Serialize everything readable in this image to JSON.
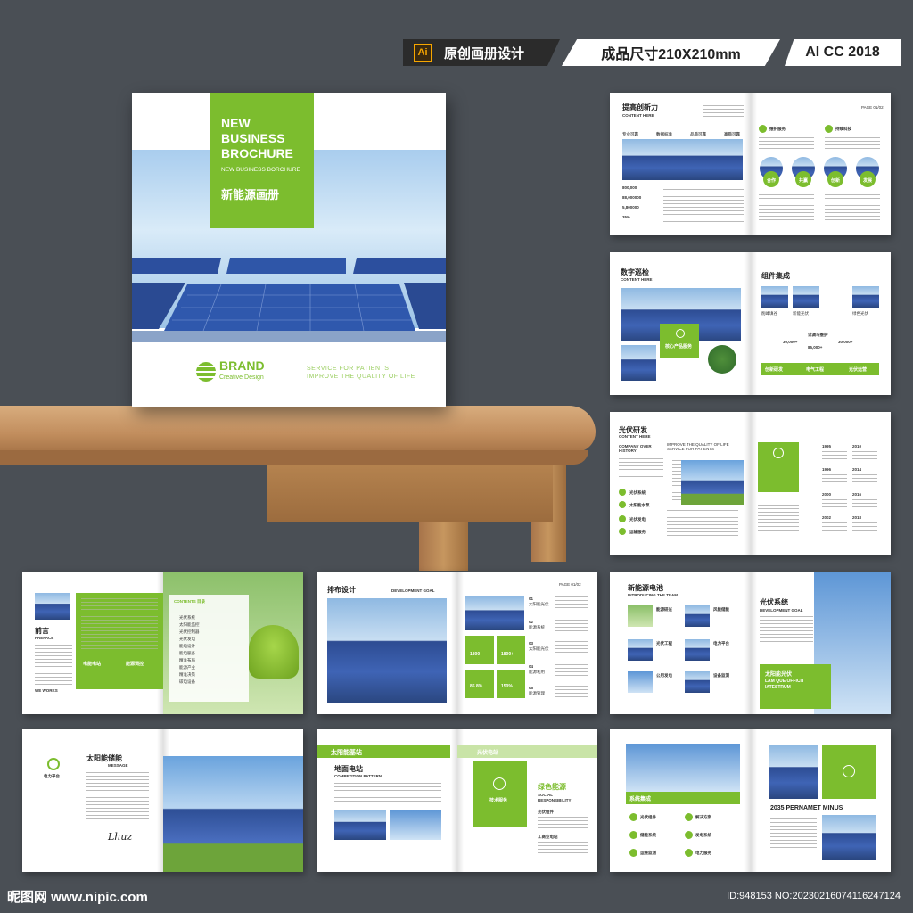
{
  "header": {
    "ai_icon": "Ai",
    "badge_title": "原创画册设计",
    "badge_size": "成品尺寸210X210mm",
    "badge_version": "AI CC 2018"
  },
  "cover": {
    "title_line1": "NEW",
    "title_line2": "BUSINESS",
    "title_line3": "BROCHURE",
    "subtitle": "NEW BUSINESS BORCHURE",
    "cn_title": "新能源画册",
    "brand_name": "BRAND",
    "brand_sub": "Creative Design",
    "slogan_line1": "SERVICE FOR PATIENTS",
    "slogan_line2": "IMPROVE THE QUALITY OF LIFE"
  },
  "spread1": {
    "title": "提高创新力",
    "subtitle": "CONTENT HERE",
    "tabs": [
      "专业可靠",
      "数据标准",
      "品质可靠",
      "高质可靠"
    ],
    "stats": [
      "800,000",
      "88,000000",
      "5,800000",
      "35%"
    ],
    "page": "PAGE 01/02",
    "circles": [
      "合作",
      "共赢",
      "创新",
      "发展"
    ],
    "col_heads": [
      "维护服务",
      "持续科技"
    ]
  },
  "spread2": {
    "title": "数字巡检",
    "subtitle": "CONTENT HERE",
    "right_title": "组件集成",
    "icon_label": "核心产品服务",
    "labels": [
      "削峰填谷",
      "新能光伏",
      "绿色光伏"
    ],
    "mid_label": "试调与维护",
    "stats": [
      "30,000+",
      "85,000+",
      "30,000+"
    ],
    "bar_labels": [
      "创新研发",
      "电气工程",
      "光伏运营"
    ]
  },
  "spread3": {
    "title": "光伏研发",
    "subtitle": "CONTENT HERE",
    "history": "COMPANY OVER HISTORY",
    "improve": "IMPROVE THE QUALITY OF LIFE SERVICE FOR PATIENTS",
    "steps": [
      "光伏系统",
      "太阳能水泵",
      "光伏发电",
      "运输服务"
    ],
    "years_left": [
      "1995",
      "1996",
      "2000",
      "2002"
    ],
    "years_right": [
      "2010",
      "2014",
      "2016",
      "2018"
    ]
  },
  "spread4": {
    "preface_cn": "前言",
    "preface_en": "PREFACE",
    "contents": "CONTENTS 目录",
    "items": [
      "光伏系统",
      "太阳能监控",
      "光伏控制器",
      "光伏发电",
      "能电设计",
      "能电服务",
      "精准布局",
      "能源产业",
      "精准决策",
      "碳电设备"
    ],
    "green_labels": [
      "电能电站",
      "能源调控"
    ],
    "sig": "WE WORKS"
  },
  "spread5": {
    "title": "排布设计",
    "goal": "DEVELOPMENT GOAL",
    "page": "PAGE 01/02",
    "stats": [
      "1800+",
      "1800+",
      "85.8%",
      "150%"
    ],
    "nums": [
      "01",
      "02",
      "03",
      "04",
      "05"
    ],
    "num_labels": [
      "太阳能光伏",
      "能源系统",
      "太阳能光伏",
      "能源利用",
      "能源管理"
    ]
  },
  "spread6": {
    "title": "新能源电池",
    "team": "INTRODUCING THE TEAM",
    "right_title": "光伏系统",
    "right_sub": "DEVELOPMENT GOAL",
    "green_title": "太阳能光伏",
    "green_sub1": "LAM QUE OFFICIT",
    "green_sub2": "IATESTRUM",
    "items": [
      "能源研光",
      "风能储能",
      "光伏工程",
      "电力平台",
      "公用发电",
      "设备监测"
    ]
  },
  "spread7": {
    "platform": "电力平台",
    "title": "太阳能储能",
    "message": "MESSAGE",
    "signature": "Lhuz"
  },
  "spread8": {
    "banner": "太阳能基站",
    "title": "地面电站",
    "pattern": "COMPETITION PATTERN",
    "right_banner": "光伏电站",
    "service": "技术服务",
    "green_title": "绿色能源",
    "social1": "SOCIAL",
    "social2": "RESPONSIBILITY",
    "list": [
      "光伏组件",
      "工商业电站"
    ]
  },
  "spread9": {
    "green_title": "系统集成",
    "year_title": "2035 PERNAMET MINUS",
    "items": [
      "光伏组件",
      "解决方案",
      "储能系统",
      "发电系统",
      "运维监测",
      "电力服务"
    ]
  },
  "watermark": {
    "site": "昵图网 www.nipic.com",
    "id": "ID:948153 NO:20230216074116247124"
  },
  "colors": {
    "accent": "#7cbd2e",
    "background": "#4a4f55"
  }
}
